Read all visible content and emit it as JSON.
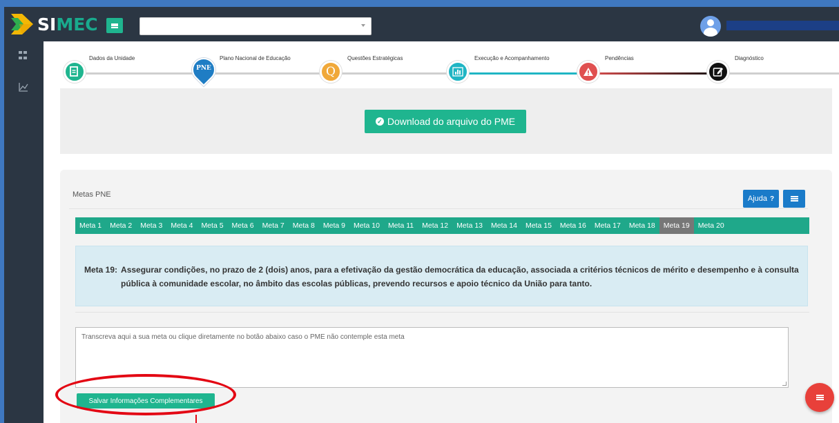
{
  "app": {
    "logo_si": "SI",
    "logo_mec": "MEC"
  },
  "stepper": {
    "steps": [
      {
        "label": "Dados da Unidade",
        "color": "#1fb58f",
        "icon": "document-icon"
      },
      {
        "label": "Plano Nacional de Educação",
        "color": "#1f7dc4",
        "icon": "pin-icon",
        "pin_text": "PNE"
      },
      {
        "label": "Questões Estratégicas",
        "color": "#f0a839",
        "icon": "question-icon",
        "glyph": "Q"
      },
      {
        "label": "Execução e Acompanhamento",
        "color": "#1fb5c4",
        "icon": "bar-chart-icon"
      },
      {
        "label": "Pendências",
        "color": "#e05050",
        "icon": "warning-icon",
        "glyph": "!"
      },
      {
        "label": "Diagnóstico",
        "color": "#111111",
        "icon": "edit-icon"
      }
    ]
  },
  "download": {
    "label": "Download do arquivo do PME"
  },
  "metas": {
    "title": "Metas PNE",
    "ajuda_label": "Ajuda",
    "ajuda_glyph": "?",
    "tabs": [
      "Meta 1",
      "Meta 2",
      "Meta 3",
      "Meta 4",
      "Meta 5",
      "Meta 6",
      "Meta 7",
      "Meta 8",
      "Meta 9",
      "Meta 10",
      "Meta 11",
      "Meta 12",
      "Meta 13",
      "Meta 14",
      "Meta 15",
      "Meta 16",
      "Meta 17",
      "Meta 18",
      "Meta 19",
      "Meta 20"
    ],
    "active_tab": "Meta 19",
    "description_label": "Meta 19:",
    "description_text": "Assegurar condições, no prazo de 2 (dois) anos, para a efetivação da gestão democrática da educação, associada a critérios técnicos de mérito e desempenho e à consulta pública à comunidade escolar, no âmbito das escolas públicas, prevendo recursos e apoio técnico da União para tanto."
  },
  "form": {
    "textarea_placeholder": "Transcreva aqui a sua meta ou clique diretamente no botão abaixo caso o PME não contemple esta meta",
    "save_label": "Salvar Informações Complementares"
  },
  "colors": {
    "accent": "#1fb58f",
    "primary": "#1a7bc9",
    "annotation": "#e30613"
  }
}
